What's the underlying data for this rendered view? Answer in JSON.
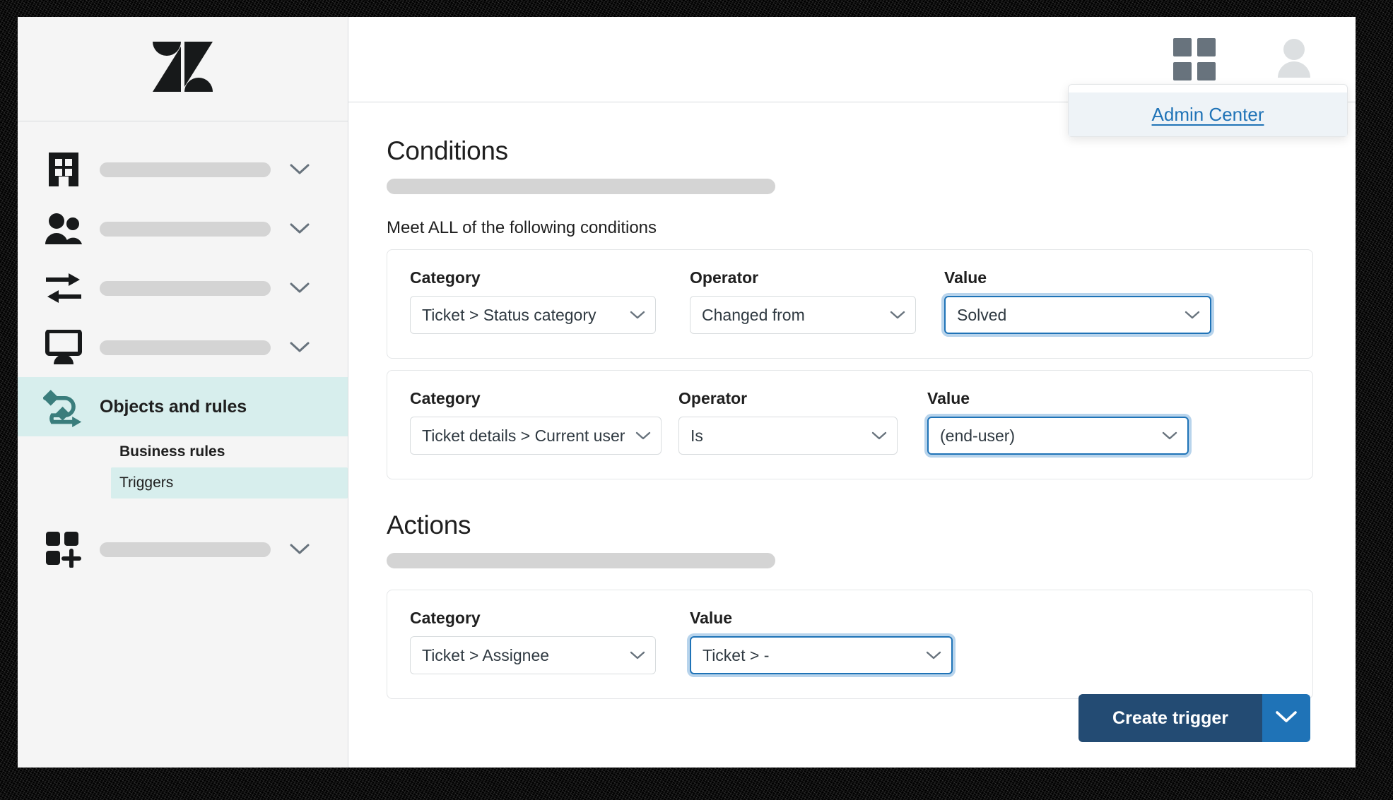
{
  "window": {
    "brand_icon": "zendesk-logo"
  },
  "sidebar": {
    "nav": [
      {
        "icon": "building-icon",
        "label": "",
        "placeholder": true,
        "chevron": true,
        "selected": false
      },
      {
        "icon": "people-icon",
        "label": "",
        "placeholder": true,
        "chevron": true,
        "selected": false
      },
      {
        "icon": "transfer-icon",
        "label": "",
        "placeholder": true,
        "chevron": true,
        "selected": false
      },
      {
        "icon": "monitor-icon",
        "label": "",
        "placeholder": true,
        "chevron": true,
        "selected": false
      },
      {
        "icon": "workflow-icon",
        "label": "Objects and rules",
        "placeholder": false,
        "chevron": false,
        "selected": true
      },
      {
        "icon": "apps-add-icon",
        "label": "",
        "placeholder": true,
        "chevron": true,
        "selected": false
      }
    ],
    "sub_items": [
      {
        "label": "Business rules",
        "bold": true,
        "active": false
      },
      {
        "label": "Triggers",
        "bold": false,
        "active": true
      }
    ]
  },
  "topbar": {
    "grid_icon": "apps-grid-icon",
    "avatar_icon": "user-avatar-icon",
    "dropdown": {
      "items": [
        {
          "label": "Admin Center"
        }
      ]
    }
  },
  "content": {
    "conditions": {
      "title": "Conditions",
      "meet_text": "Meet ALL of the following conditions",
      "labels": {
        "category": "Category",
        "operator": "Operator",
        "value": "Value"
      },
      "rows": [
        {
          "category": "Ticket > Status category",
          "operator": "Changed from",
          "value": "Solved",
          "value_focused": true
        },
        {
          "category": "Ticket details > Current user",
          "operator": "Is",
          "value": "(end-user)",
          "value_focused": true
        }
      ]
    },
    "actions": {
      "title": "Actions",
      "labels": {
        "category": "Category",
        "value": "Value"
      },
      "rows": [
        {
          "category": "Ticket > Assignee",
          "value": "Ticket > -",
          "value_focused": true
        }
      ]
    }
  },
  "footer": {
    "primary_label": "Create trigger",
    "chevron_icon": "chevron-down-icon"
  },
  "colors": {
    "accent_blue": "#1f73b7",
    "primary_dark": "#234b73",
    "selected_teal": "#d7eeed",
    "icon_teal": "#3a7d7c",
    "border_gray": "#d8dcde",
    "placeholder_gray": "#d4d4d4",
    "sidebar_bg": "#f5f5f5",
    "dropdown_item_bg": "#eef3f7"
  }
}
